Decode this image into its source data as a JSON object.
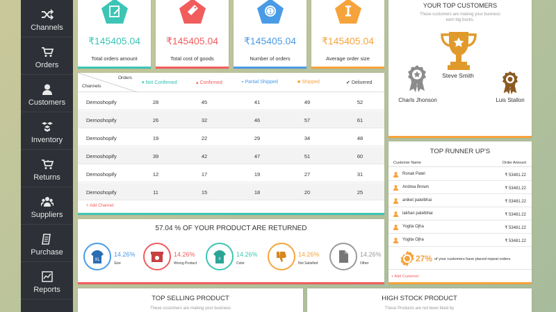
{
  "sidebar": {
    "items": [
      {
        "label": "Channels",
        "icon": "shuffle-icon"
      },
      {
        "label": "Orders",
        "icon": "cart-icon"
      },
      {
        "label": "Customers",
        "icon": "user-icon"
      },
      {
        "label": "Inventory",
        "icon": "boxes-icon"
      },
      {
        "label": "Returns",
        "icon": "return-cart-icon"
      },
      {
        "label": "Suppliers",
        "icon": "users-icon"
      },
      {
        "label": "Purchase",
        "icon": "receipt-icon"
      },
      {
        "label": "Reports",
        "icon": "chart-icon"
      }
    ]
  },
  "stats": [
    {
      "value": "₹145405.04",
      "caption": "Total orders amount",
      "color": "#3cc5b4",
      "icon": "edit-icon"
    },
    {
      "value": "₹145405.04",
      "caption": "Total cost of goods",
      "color": "#f15c5c",
      "icon": "tag-icon"
    },
    {
      "value": "₹145405.04",
      "caption": "Number of orders",
      "color": "#4a9be6",
      "icon": "coin-icon"
    },
    {
      "value": "₹145405.04",
      "caption": "Average order size",
      "color": "#f7a33b",
      "icon": "info-icon"
    }
  ],
  "orders_table": {
    "corner_top": "Orders",
    "corner_bottom": "Channels",
    "headers": [
      {
        "label": "Not Confirmed",
        "color": "#2fbfb0",
        "icon": "thumbs-down-icon"
      },
      {
        "label": "Confirmed",
        "color": "#f15c5c",
        "icon": "thumbs-up-icon"
      },
      {
        "label": "Partial Shipped",
        "color": "#4a9be6",
        "icon": "box-icon"
      },
      {
        "label": "Shipped",
        "color": "#f7a33b",
        "icon": "truck-icon"
      },
      {
        "label": "Delivered",
        "color": "#444444",
        "icon": "check-circle-icon"
      }
    ],
    "rows": [
      {
        "channel": "Demoshopify",
        "values": [
          "28",
          "45",
          "41",
          "49",
          "52"
        ]
      },
      {
        "channel": "Demoshopify",
        "values": [
          "26",
          "32",
          "46",
          "57",
          "61"
        ]
      },
      {
        "channel": "Demoshopify",
        "values": [
          "19",
          "22",
          "29",
          "34",
          "48"
        ]
      },
      {
        "channel": "Demoshopify",
        "values": [
          "39",
          "42",
          "47",
          "51",
          "60"
        ]
      },
      {
        "channel": "Demoshopify",
        "values": [
          "12",
          "17",
          "19",
          "27",
          "31"
        ]
      },
      {
        "channel": "Demoshopify",
        "values": [
          "11",
          "15",
          "18",
          "20",
          "25"
        ]
      }
    ],
    "add_label": "+ Add Channel"
  },
  "top_customers": {
    "title": "YOUR TOP CUSTOMERS",
    "subtitle": "These customers are making your business earn big bucks.",
    "first": "Steve Smith",
    "second": "Charls Jhonson",
    "third": "Luis Stallon"
  },
  "returns": {
    "title": "57.04 % OF YOUR PRODUCT ARE RETURNED",
    "items": [
      {
        "pct": "14.26%",
        "label": "Size",
        "color": "#4a9be6",
        "icon": "shirt-xl-icon"
      },
      {
        "pct": "14.26%",
        "label": "Wrong Product",
        "color": "#f15c5c",
        "icon": "package-icon"
      },
      {
        "pct": "14.26%",
        "label": "Color",
        "color": "#3cc5b4",
        "icon": "shirt-color-icon"
      },
      {
        "pct": "14.26%",
        "label": "Not Satisfied",
        "color": "#f7a33b",
        "icon": "thumbs-down-icon"
      },
      {
        "pct": "14.26%",
        "label": "Other",
        "color": "#999999",
        "icon": "document-icon"
      }
    ]
  },
  "runner_ups": {
    "title": "TOP RUNNER UP'S",
    "col_name": "Customer Name",
    "col_amount": "Order Amount",
    "rows": [
      {
        "name": "Ronak Patel",
        "amount": "₹ 53481.22"
      },
      {
        "name": "Andrea Brown",
        "amount": "₹ 53481.22"
      },
      {
        "name": "aniket patelbhai",
        "amount": "₹ 53481.22"
      },
      {
        "name": "lakhan patelbhai",
        "amount": "₹ 53481.22"
      },
      {
        "name": "Yogita Ojha",
        "amount": "₹ 53481.22"
      },
      {
        "name": "Yogita Ojha",
        "amount": "₹ 53481.22"
      }
    ],
    "repeat_pct": "27%",
    "repeat_text": "of your customers have placed repeat orders.",
    "add_label": "+ Add Customer"
  },
  "top_selling": {
    "title": "TOP SELLING PRODUCT",
    "subtitle": "These customers are making your business"
  },
  "high_stock": {
    "title": "HIGH STOCK PRODUCT",
    "subtitle": "These Products are not been liked by"
  }
}
